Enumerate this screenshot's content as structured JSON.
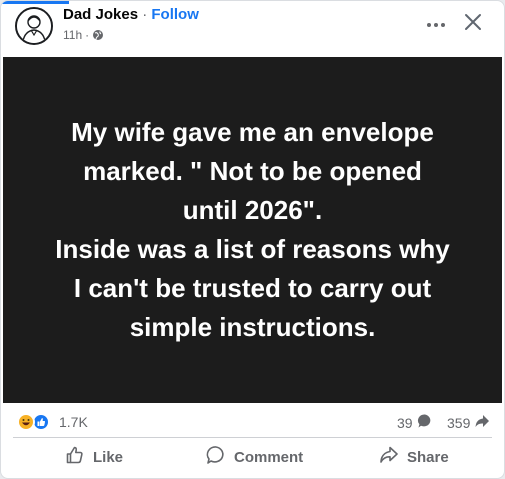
{
  "post": {
    "author": "Dad Jokes",
    "separator": "·",
    "follow_label": "Follow",
    "time": "11h",
    "time_separator": "·",
    "audience_icon": "globe-icon",
    "more_icon": "more-dots-icon",
    "close_icon": "close-icon"
  },
  "content": {
    "joke_text": "My wife gave me an envelope\nmarked. \" Not to be opened\nuntil 2026\".\nInside was a list of reasons why\nI can't be trusted to carry out\nsimple instructions."
  },
  "stats": {
    "reaction_icons": [
      "haha-icon",
      "like-icon"
    ],
    "reaction_count": "1.7K",
    "comment_count": "39",
    "share_count": "359"
  },
  "actions": {
    "like_label": "Like",
    "comment_label": "Comment",
    "share_label": "Share"
  },
  "colors": {
    "accent": "#1877f2",
    "image_background": "#1c1c1c",
    "secondary_text": "#65676b"
  }
}
